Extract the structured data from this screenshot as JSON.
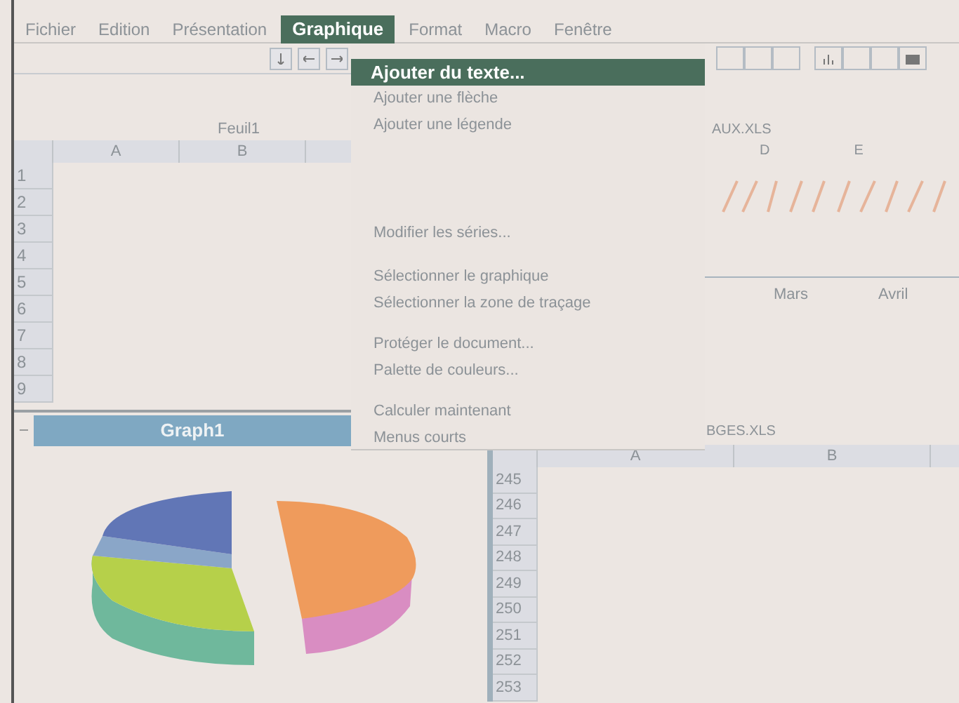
{
  "menu_bar": [
    {
      "label": "Fichier",
      "selected": false
    },
    {
      "label": "Edition",
      "selected": false
    },
    {
      "label": "Présentation",
      "selected": false
    },
    {
      "label": "Graphique",
      "selected": true
    },
    {
      "label": "Format",
      "selected": false
    },
    {
      "label": "Macro",
      "selected": false
    },
    {
      "label": "Fenêtre",
      "selected": false
    }
  ],
  "menu": {
    "groups": [
      [
        {
          "label": "Ajouter du texte...",
          "selected": true
        },
        {
          "label": "Ajouter une flèche",
          "selected": false
        },
        {
          "label": "Ajouter une légende",
          "selected": false
        }
      ],
      [
        {
          "label": "Modifier les séries...",
          "selected": false
        }
      ],
      [
        {
          "label": "Sélectionner le graphique",
          "selected": false
        },
        {
          "label": "Sélectionner la zone de traçage",
          "selected": false
        }
      ],
      [
        {
          "label": "Protéger le document...",
          "selected": false
        },
        {
          "label": "Palette de couleurs...",
          "selected": false
        }
      ],
      [
        {
          "label": "Calculer maintenant",
          "selected": false
        },
        {
          "label": "Menus courts",
          "selected": false
        }
      ]
    ]
  },
  "sheet_window": {
    "title": "Feuil1",
    "columns": [
      "A",
      "B"
    ],
    "rows": [
      "1",
      "2",
      "3",
      "4",
      "5",
      "6",
      "7",
      "8",
      "9"
    ]
  },
  "graph_window": {
    "title": "Graph1",
    "active": true
  },
  "chart_window": {
    "title": "AUX.XLS",
    "columns": [
      "D",
      "E"
    ],
    "labels": [
      "Mars",
      "Avril"
    ]
  },
  "data_window": {
    "title": "BGES.XLS",
    "columns": [
      "A",
      "B"
    ],
    "rows": [
      "245",
      "246",
      "247",
      "248",
      "249",
      "250",
      "251",
      "252",
      "253"
    ]
  }
}
